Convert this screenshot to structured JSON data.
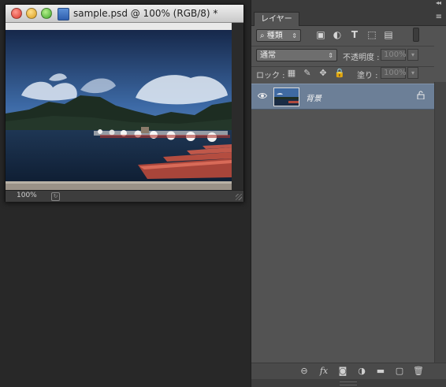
{
  "document": {
    "title": "sample.psd @ 100% (RGB/8) *",
    "zoom": "100%"
  },
  "panel": {
    "collapse_glyph": "◂◂",
    "tab_label": "レイヤー",
    "menu_glyph": "≡",
    "filter_kind": "種類",
    "blend_mode": "通常",
    "opacity_label": "不透明度 :",
    "opacity_value": "100%",
    "lock_label": "ロック :",
    "fill_label": "塗り :",
    "fill_value": "100%"
  },
  "layers": [
    {
      "name": "背景",
      "visible": true,
      "locked": true
    }
  ],
  "icons": {
    "search": "⌕",
    "image_filter": "▣",
    "adjust_filter": "◐",
    "type_filter": "T",
    "shape_filter": "⬚",
    "smart_filter": "▤",
    "eye": "👁",
    "lock": "🔓",
    "lock_pixels": "▦",
    "lock_paint": "✎",
    "lock_move": "✥",
    "lock_all": "🔒",
    "link": "⊖",
    "fx": "fx",
    "mask": "◙",
    "adjustment": "◑",
    "folder": "▬",
    "new_layer": "▢",
    "trash": "🗑",
    "dropdown": "▾",
    "updown": "⇕"
  },
  "colors": {
    "panel_bg": "#535353",
    "selected_layer": "#6c7f97",
    "workspace_bg": "#282828"
  }
}
